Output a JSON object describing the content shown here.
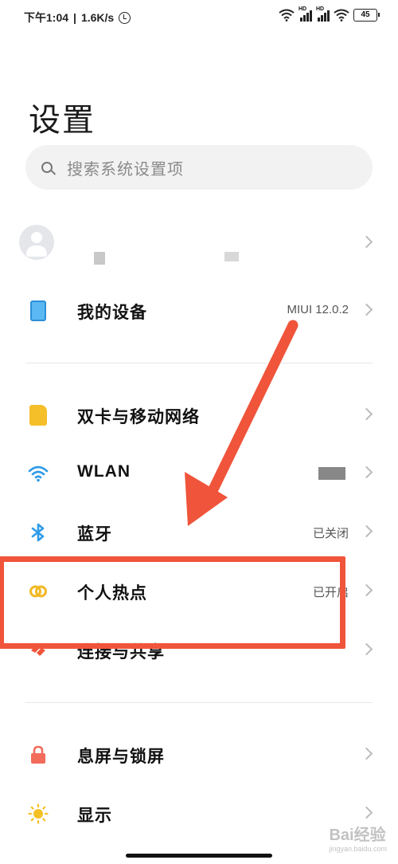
{
  "status_bar": {
    "time": "下午1:04",
    "speed": "1.6K/s",
    "battery": "45",
    "hd": "HD"
  },
  "page_title": "设置",
  "search": {
    "placeholder": "搜索系统设置项"
  },
  "rows": {
    "my_device": {
      "label": "我的设备",
      "value": "MIUI 12.0.2"
    },
    "sim": {
      "label": "双卡与移动网络"
    },
    "wlan": {
      "label": "WLAN"
    },
    "bluetooth": {
      "label": "蓝牙",
      "value": "已关闭"
    },
    "hotspot": {
      "label": "个人热点",
      "value": "已开启"
    },
    "share": {
      "label": "连接与共享"
    },
    "lock": {
      "label": "息屏与锁屏"
    },
    "display": {
      "label": "显示"
    }
  },
  "annotation": {
    "color": "#f0543a"
  },
  "watermark": {
    "text": "Bai经验",
    "sub": "jingyan.baidu.com"
  }
}
